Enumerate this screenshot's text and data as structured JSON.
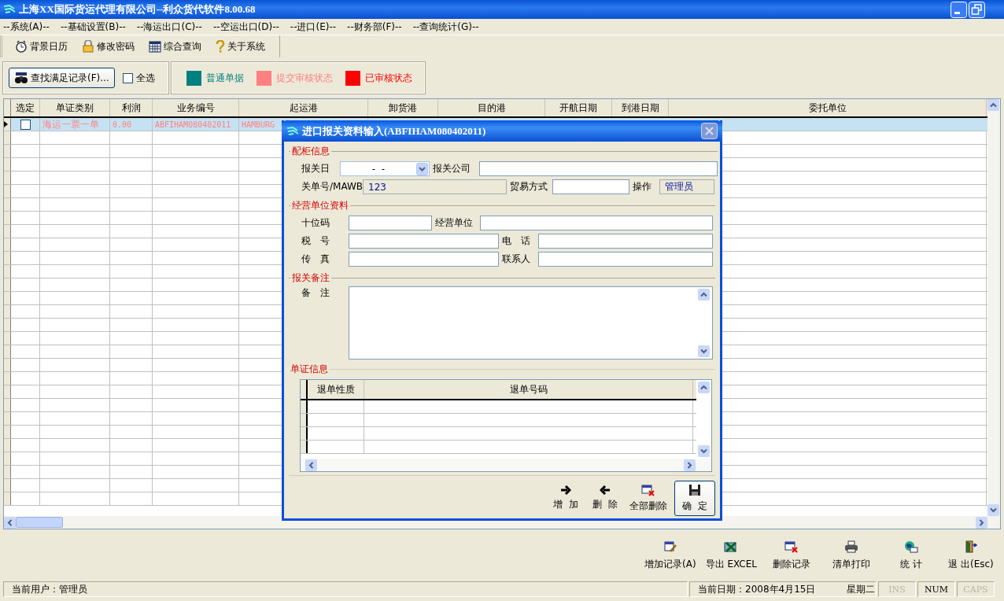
{
  "window": {
    "title": "上海XX国际货运代理有限公司--利众货代软件8.00.68"
  },
  "menu": [
    "--系统(A)--",
    "--基础设置(B)--",
    "--海运出口(C)--",
    "--空运出口(D)--",
    "--进口(E)--",
    "--财务部(F)--",
    "--查询统计(G)--"
  ],
  "toolbar": [
    "背景日历",
    "修改密码",
    "综合查询",
    "关于系统"
  ],
  "filter": {
    "find_button": "查找满足记录(F)...",
    "select_all": {
      "label": "全选",
      "checked": false
    },
    "legend": [
      {
        "label": "普通单据",
        "color": "#008080"
      },
      {
        "label": "提交审核状态",
        "color": "#ff8080"
      },
      {
        "label": "已审核状态",
        "color": "#ff0000"
      }
    ]
  },
  "grid": {
    "columns": [
      "选定",
      "单证类别",
      "利润",
      "业务编号",
      "起运港",
      "卸货港",
      "目的港",
      "开航日期",
      "到港日期",
      "委托单位"
    ],
    "rows": [
      {
        "selected": true,
        "checked": false,
        "color": "#ff8080",
        "cells": [
          "",
          "海运一票一单",
          "0.00",
          "ABFIHAM080402011",
          "HAMBURG"
        ]
      }
    ]
  },
  "dialog": {
    "title": "进口报关资料输入(ABFIHAM080402011)",
    "groups": [
      {
        "title": "配柜信息",
        "fields": [
          {
            "label": "报关日",
            "kind": "dropdown",
            "value": "-  -",
            "readonly": false
          },
          {
            "label": "报关公司",
            "kind": "text",
            "readonly": false
          },
          {
            "label": "关单号/MAWB",
            "kind": "text",
            "value": "123",
            "readonly": true
          },
          {
            "label": "贸易方式",
            "kind": "text",
            "readonly": false
          },
          {
            "label": "操作",
            "kind": "text",
            "value": "管理员",
            "readonly": true
          }
        ]
      },
      {
        "title": "经营单位资料",
        "fields": [
          {
            "label": "十位码",
            "kind": "text",
            "readonly": false
          },
          {
            "label": "经营单位",
            "kind": "text",
            "readonly": false
          },
          {
            "label": "税 号",
            "kind": "text",
            "readonly": false
          },
          {
            "label": "电 话",
            "kind": "text",
            "readonly": false
          },
          {
            "label": "传 真",
            "kind": "text",
            "readonly": false
          },
          {
            "label": "联系人",
            "kind": "text",
            "readonly": false
          }
        ]
      },
      {
        "title": "报关备注",
        "fields": [
          {
            "label": "备 注",
            "kind": "memo",
            "readonly": false
          }
        ]
      },
      {
        "title": "单证信息",
        "columns": [
          "退单性质",
          "退单号码"
        ]
      }
    ],
    "buttons": [
      {
        "label": "增 加",
        "default": false
      },
      {
        "label": "删 除",
        "default": false
      },
      {
        "label": "全部删除",
        "default": false
      },
      {
        "label": "确 定",
        "default": true
      }
    ]
  },
  "actions": [
    "增加记录(A)",
    "导出 EXCEL",
    "删除记录",
    "清单打印",
    "统 计",
    "退 出(Esc)"
  ],
  "status_bar": {
    "user": "当前用户：管理员",
    "date": "当前日期：2008年4月15日",
    "weekday": "星期二",
    "keys": [
      {
        "label": "INS",
        "on": false
      },
      {
        "label": "NUM",
        "on": true
      },
      {
        "label": "CAPS",
        "on": false
      }
    ]
  }
}
